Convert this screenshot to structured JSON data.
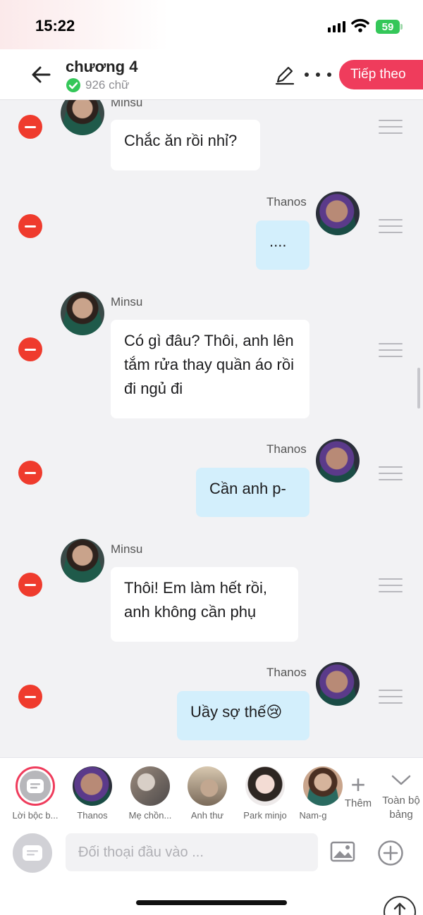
{
  "status_bar": {
    "time": "15:22",
    "battery": "59"
  },
  "header": {
    "title": "chương 4",
    "word_count": "926 chữ",
    "next_label": "Tiếp theo"
  },
  "messages": [
    {
      "sender": "Minsu",
      "side": "left",
      "text": "Chắc ăn rồi nhỉ?"
    },
    {
      "sender": "Thanos",
      "side": "right",
      "text": "...."
    },
    {
      "sender": "Minsu",
      "side": "left",
      "text": "Có gì đâu? Thôi, anh lên tắm rửa thay quần áo rồi đi ngủ đi"
    },
    {
      "sender": "Thanos",
      "side": "right",
      "text": "Cần anh p-"
    },
    {
      "sender": "Minsu",
      "side": "left",
      "text": "Thôi! Em làm hết rồi, anh không cần phụ"
    },
    {
      "sender": "Thanos",
      "side": "right",
      "text": "Uầy sợ thế😢"
    }
  ],
  "characters": [
    {
      "label": "Lời bộc b..."
    },
    {
      "label": "Thanos"
    },
    {
      "label": "Mẹ chồn..."
    },
    {
      "label": "Anh thư"
    },
    {
      "label": "Park minjo"
    },
    {
      "label": "Nam-g"
    }
  ],
  "char_actions": {
    "add_label": "Thêm",
    "all_label": "Toàn bộ bảng"
  },
  "input": {
    "placeholder": "Đối thoại đầu vào ..."
  },
  "icons": {
    "back": "arrow-left-icon",
    "verified": "check-circle-icon",
    "edit": "pencil-icon",
    "more": "more-dots-icon",
    "delete": "minus-circle-icon",
    "drag": "drag-handle-icon",
    "image": "image-icon",
    "add": "plus-circle-icon",
    "expand": "chevron-down-icon",
    "scroll-up": "arrow-up-icon"
  },
  "colors": {
    "accent": "#ef3c5c",
    "delete": "#ef3b2d",
    "right_bubble": "#d3effc",
    "verified": "#34c759"
  }
}
